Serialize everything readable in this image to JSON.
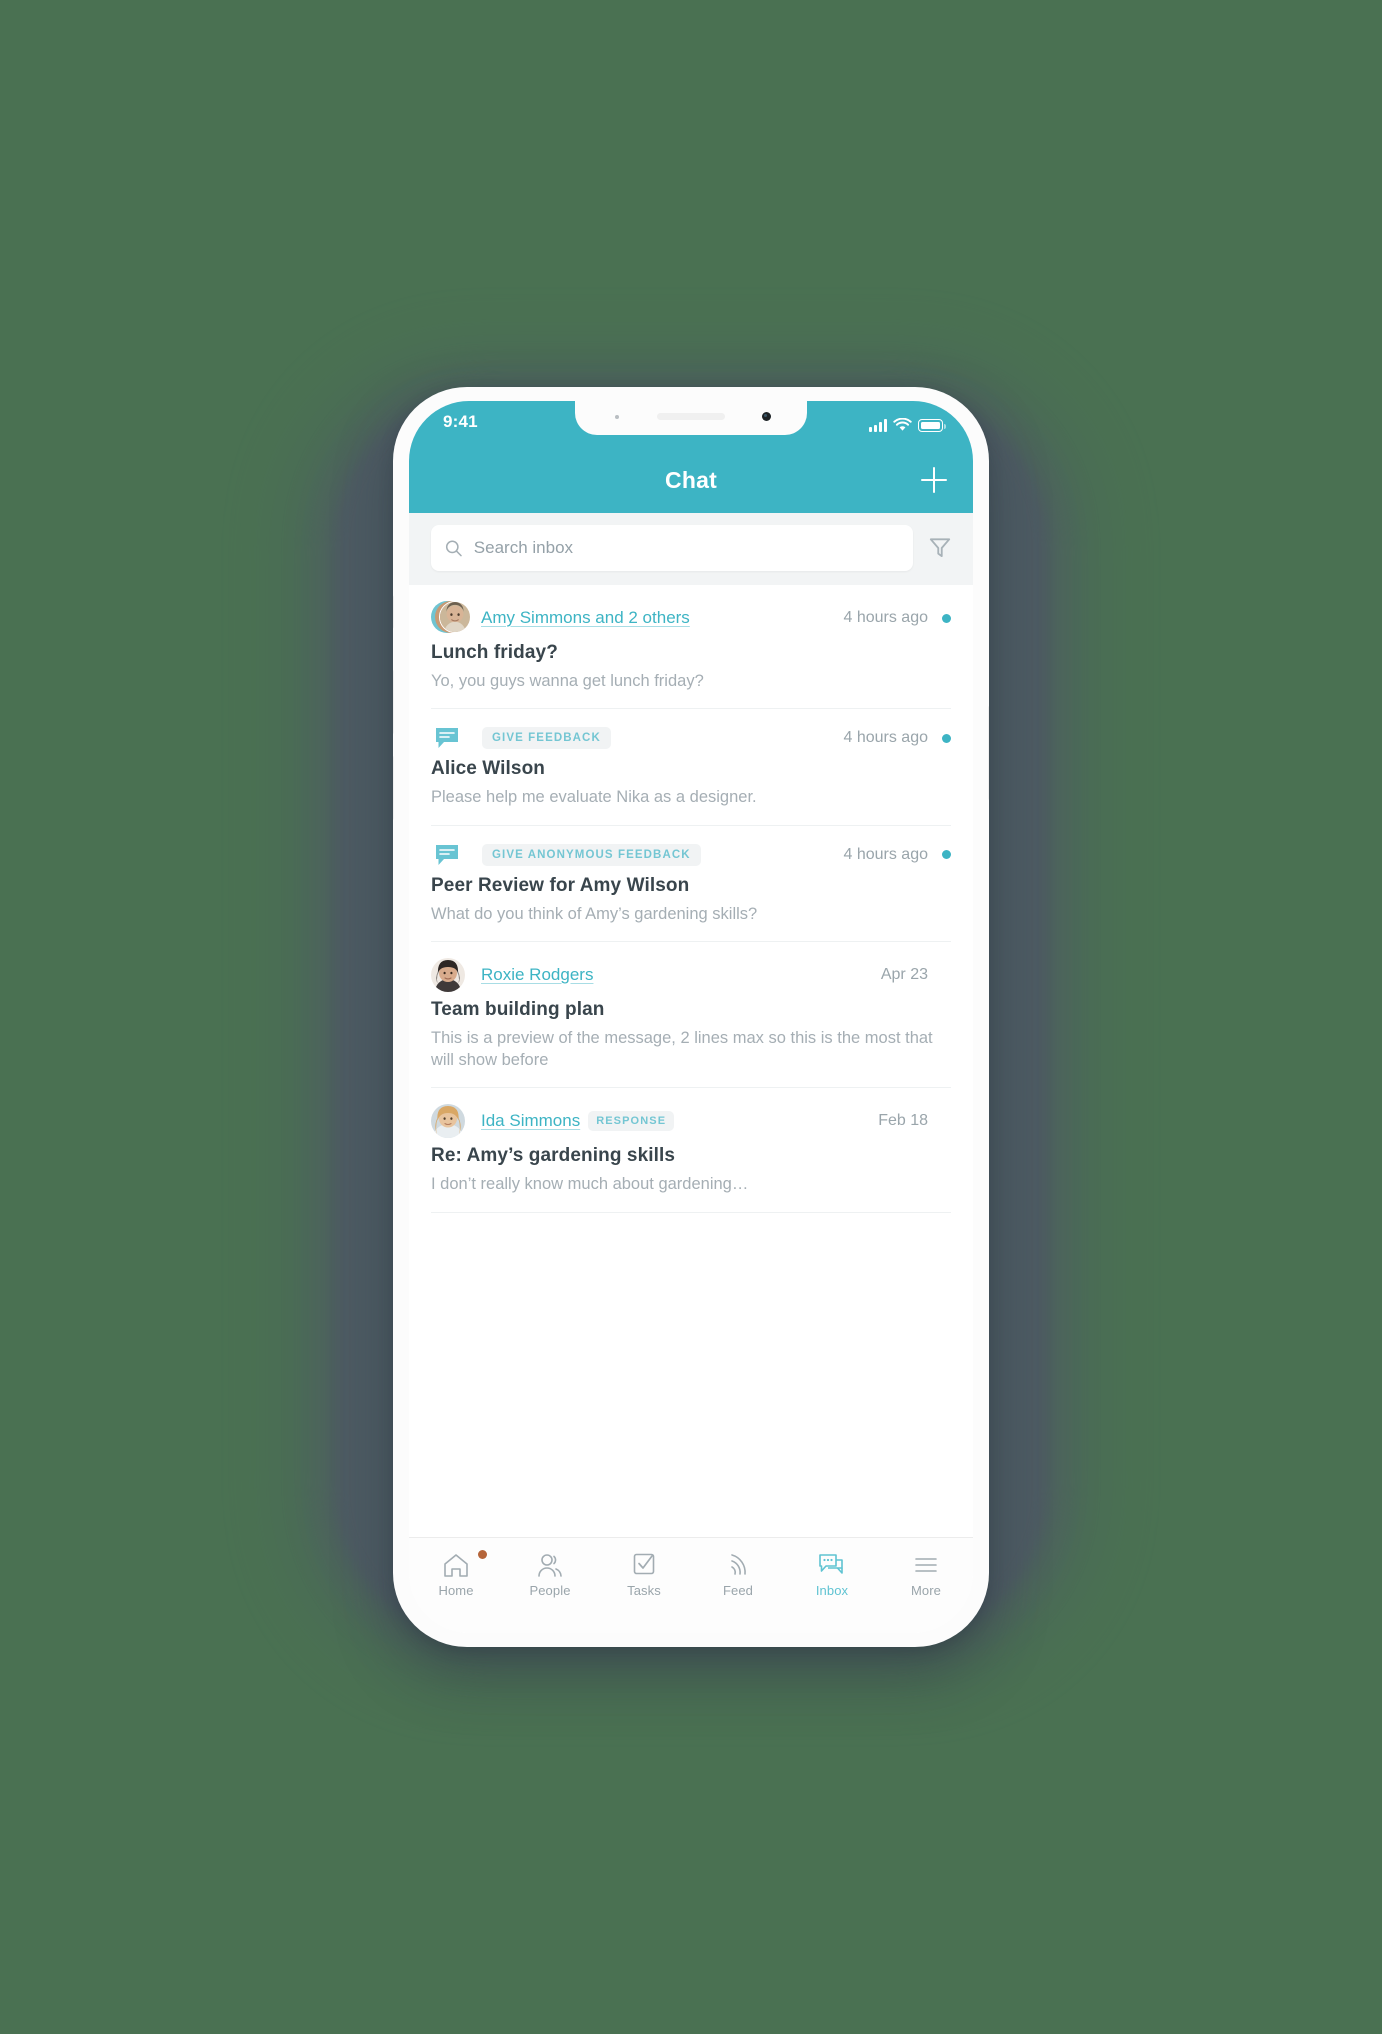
{
  "status_bar": {
    "time": "9:41",
    "signal_icon": "cellular-signal-icon",
    "wifi_icon": "wifi-icon",
    "battery_icon": "battery-icon"
  },
  "header": {
    "title": "Chat",
    "add_icon": "plus-icon"
  },
  "search": {
    "placeholder": "Search inbox",
    "value": "",
    "search_icon": "search-icon",
    "filter_icon": "filter-icon"
  },
  "threads": [
    {
      "avatar_type": "stacked",
      "sender": "Amy Simmons and 2 others",
      "badge": "",
      "time": "4 hours ago",
      "unread": true,
      "subject": "Lunch friday?",
      "preview": "Yo, you guys wanna get lunch friday?"
    },
    {
      "avatar_type": "bubble",
      "sender": "",
      "badge": "GIVE FEEDBACK",
      "time": "4 hours ago",
      "unread": true,
      "subject": "Alice Wilson",
      "preview": "Please help me evaluate Nika as a designer."
    },
    {
      "avatar_type": "bubble",
      "sender": "",
      "badge": "GIVE ANONYMOUS FEEDBACK",
      "time": "4 hours ago",
      "unread": true,
      "subject": "Peer Review for Amy Wilson",
      "preview": "What do you think of Amy’s gardening skills?"
    },
    {
      "avatar_type": "photo",
      "sender": "Roxie Rodgers",
      "badge": "",
      "time": "Apr 23",
      "unread": false,
      "subject": "Team building plan",
      "preview": "This is a preview of the message, 2 lines max so this is the most that will show before"
    },
    {
      "avatar_type": "photo",
      "sender": "Ida Simmons",
      "badge": "RESPONSE",
      "time": "Feb 18",
      "unread": false,
      "subject": "Re: Amy’s gardening skills",
      "preview": "I don’t really know much about gardening…"
    }
  ],
  "tabs": [
    {
      "label": "Home",
      "icon": "home-icon",
      "active": false,
      "badge": true
    },
    {
      "label": "People",
      "icon": "people-icon",
      "active": false,
      "badge": false
    },
    {
      "label": "Tasks",
      "icon": "tasks-icon",
      "active": false,
      "badge": false
    },
    {
      "label": "Feed",
      "icon": "feed-icon",
      "active": false,
      "badge": false
    },
    {
      "label": "Inbox",
      "icon": "inbox-icon",
      "active": true,
      "badge": false
    },
    {
      "label": "More",
      "icon": "more-icon",
      "active": false,
      "badge": false
    }
  ],
  "colors": {
    "accent": "#3db4c4",
    "accent_light": "#74c6d3",
    "page_background": "#4a7152",
    "text_dark": "#39454c",
    "text_muted": "#9aa5ab",
    "badge_dot": "#b5653a"
  }
}
